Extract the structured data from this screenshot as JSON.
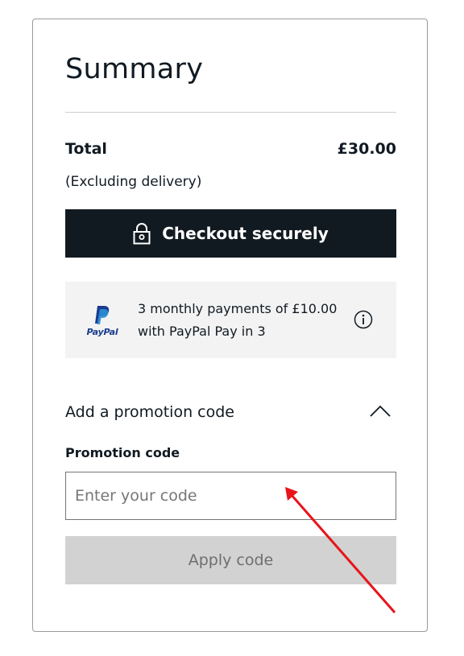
{
  "summary": {
    "title": "Summary",
    "total_label": "Total",
    "total_value": "£30.00",
    "excluding_note": "(Excluding delivery)"
  },
  "checkout": {
    "label": "Checkout securely",
    "icon": "lock-icon"
  },
  "paypal": {
    "logo_text": "PayPal",
    "line1": "3 monthly payments of £10.00",
    "line2": "with PayPal Pay in 3",
    "info_icon": "info-icon"
  },
  "promotion": {
    "header_label": "Add a promotion code",
    "expanded": true,
    "field_label": "Promotion code",
    "input_value": "",
    "input_placeholder": "Enter your code",
    "apply_label": "Apply code"
  },
  "colors": {
    "checkout_bg": "#121a21",
    "apply_disabled_bg": "#d2d2d2",
    "paypal_box_bg": "#f3f3f3",
    "annotation_arrow": "#e8141b"
  }
}
